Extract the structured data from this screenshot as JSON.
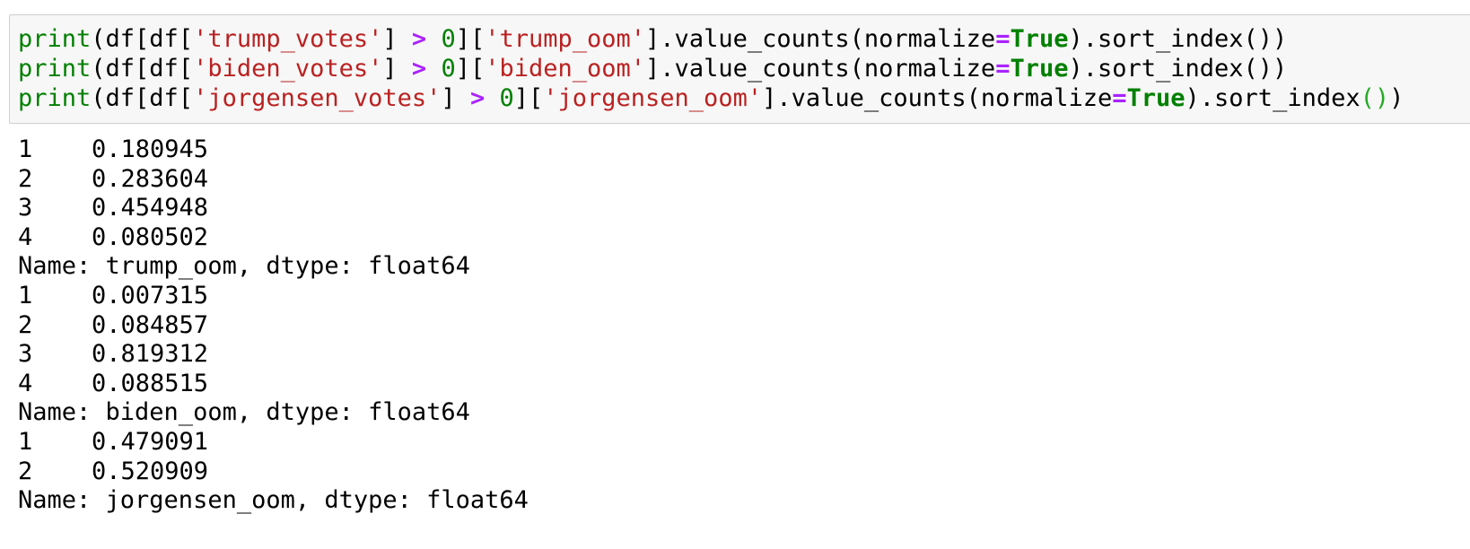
{
  "input_cell": {
    "lines": [
      {
        "tokens": [
          {
            "text": "print",
            "kind": "builtin"
          },
          {
            "text": "(df[df[",
            "kind": "name"
          },
          {
            "text": "'trump_votes'",
            "kind": "str"
          },
          {
            "text": "] ",
            "kind": "name"
          },
          {
            "text": ">",
            "kind": "op"
          },
          {
            "text": " ",
            "kind": "name"
          },
          {
            "text": "0",
            "kind": "num"
          },
          {
            "text": "][",
            "kind": "name"
          },
          {
            "text": "'trump_oom'",
            "kind": "str"
          },
          {
            "text": "].value_counts(normalize",
            "kind": "name"
          },
          {
            "text": "=",
            "kind": "op"
          },
          {
            "text": "True",
            "kind": "kw"
          },
          {
            "text": ").sort_index())",
            "kind": "name"
          }
        ]
      },
      {
        "tokens": [
          {
            "text": "print",
            "kind": "builtin"
          },
          {
            "text": "(df[df[",
            "kind": "name"
          },
          {
            "text": "'biden_votes'",
            "kind": "str"
          },
          {
            "text": "] ",
            "kind": "name"
          },
          {
            "text": ">",
            "kind": "op"
          },
          {
            "text": " ",
            "kind": "name"
          },
          {
            "text": "0",
            "kind": "num"
          },
          {
            "text": "][",
            "kind": "name"
          },
          {
            "text": "'biden_oom'",
            "kind": "str"
          },
          {
            "text": "].value_counts(normalize",
            "kind": "name"
          },
          {
            "text": "=",
            "kind": "op"
          },
          {
            "text": "True",
            "kind": "kw"
          },
          {
            "text": ").sort_index())",
            "kind": "name"
          }
        ]
      },
      {
        "tokens": [
          {
            "text": "print",
            "kind": "builtin"
          },
          {
            "text": "(df[df[",
            "kind": "name"
          },
          {
            "text": "'jorgensen_votes'",
            "kind": "str"
          },
          {
            "text": "] ",
            "kind": "name"
          },
          {
            "text": ">",
            "kind": "op"
          },
          {
            "text": " ",
            "kind": "name"
          },
          {
            "text": "0",
            "kind": "num"
          },
          {
            "text": "][",
            "kind": "name"
          },
          {
            "text": "'jorgensen_oom'",
            "kind": "str"
          },
          {
            "text": "].value_counts(normalize",
            "kind": "name"
          },
          {
            "text": "=",
            "kind": "op"
          },
          {
            "text": "True",
            "kind": "kw"
          },
          {
            "text": ").sort_index",
            "kind": "name"
          },
          {
            "text": "()",
            "kind": "paren-match"
          },
          {
            "text": ")",
            "kind": "name"
          }
        ]
      }
    ]
  },
  "output_cell": {
    "series": [
      {
        "rows": [
          {
            "index": "1",
            "value": "0.180945"
          },
          {
            "index": "2",
            "value": "0.283604"
          },
          {
            "index": "3",
            "value": "0.454948"
          },
          {
            "index": "4",
            "value": "0.080502"
          }
        ],
        "footer": "Name: trump_oom, dtype: float64"
      },
      {
        "rows": [
          {
            "index": "1",
            "value": "0.007315"
          },
          {
            "index": "2",
            "value": "0.084857"
          },
          {
            "index": "3",
            "value": "0.819312"
          },
          {
            "index": "4",
            "value": "0.088515"
          }
        ],
        "footer": "Name: biden_oom, dtype: float64"
      },
      {
        "rows": [
          {
            "index": "1",
            "value": "0.479091"
          },
          {
            "index": "2",
            "value": "0.520909"
          }
        ],
        "footer": "Name: jorgensen_oom, dtype: float64"
      }
    ]
  },
  "colors": {
    "input_background": "#f7f7f7",
    "input_border": "#cfcfcf",
    "builtin": "#008000",
    "string": "#ba2121",
    "operator": "#aa22ff",
    "keyword": "#008000",
    "matched_paren": "#22aa22"
  }
}
